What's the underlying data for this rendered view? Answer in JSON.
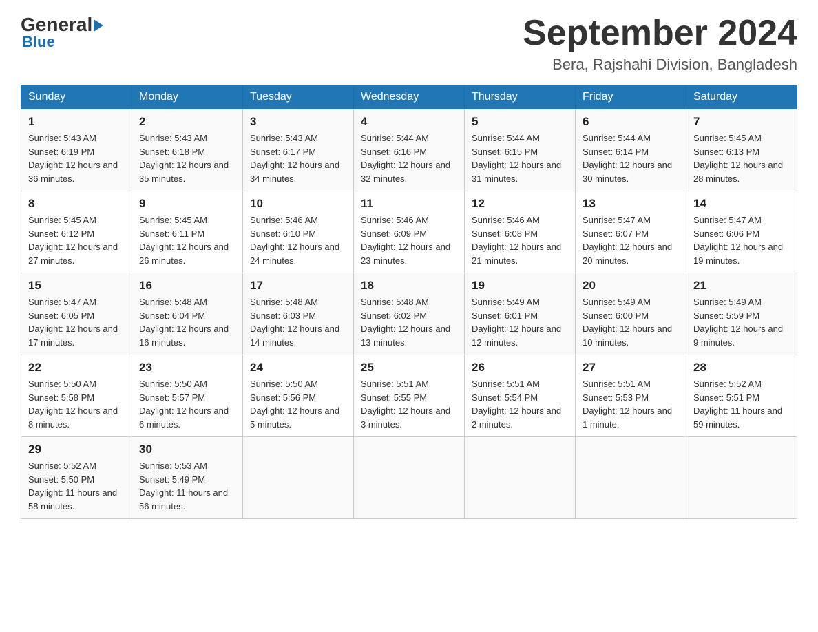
{
  "logo": {
    "general": "General",
    "blue": "Blue"
  },
  "header": {
    "title": "September 2024",
    "subtitle": "Bera, Rajshahi Division, Bangladesh"
  },
  "days_of_week": [
    "Sunday",
    "Monday",
    "Tuesday",
    "Wednesday",
    "Thursday",
    "Friday",
    "Saturday"
  ],
  "weeks": [
    [
      {
        "day": "1",
        "sunrise": "5:43 AM",
        "sunset": "6:19 PM",
        "daylight": "12 hours and 36 minutes."
      },
      {
        "day": "2",
        "sunrise": "5:43 AM",
        "sunset": "6:18 PM",
        "daylight": "12 hours and 35 minutes."
      },
      {
        "day": "3",
        "sunrise": "5:43 AM",
        "sunset": "6:17 PM",
        "daylight": "12 hours and 34 minutes."
      },
      {
        "day": "4",
        "sunrise": "5:44 AM",
        "sunset": "6:16 PM",
        "daylight": "12 hours and 32 minutes."
      },
      {
        "day": "5",
        "sunrise": "5:44 AM",
        "sunset": "6:15 PM",
        "daylight": "12 hours and 31 minutes."
      },
      {
        "day": "6",
        "sunrise": "5:44 AM",
        "sunset": "6:14 PM",
        "daylight": "12 hours and 30 minutes."
      },
      {
        "day": "7",
        "sunrise": "5:45 AM",
        "sunset": "6:13 PM",
        "daylight": "12 hours and 28 minutes."
      }
    ],
    [
      {
        "day": "8",
        "sunrise": "5:45 AM",
        "sunset": "6:12 PM",
        "daylight": "12 hours and 27 minutes."
      },
      {
        "day": "9",
        "sunrise": "5:45 AM",
        "sunset": "6:11 PM",
        "daylight": "12 hours and 26 minutes."
      },
      {
        "day": "10",
        "sunrise": "5:46 AM",
        "sunset": "6:10 PM",
        "daylight": "12 hours and 24 minutes."
      },
      {
        "day": "11",
        "sunrise": "5:46 AM",
        "sunset": "6:09 PM",
        "daylight": "12 hours and 23 minutes."
      },
      {
        "day": "12",
        "sunrise": "5:46 AM",
        "sunset": "6:08 PM",
        "daylight": "12 hours and 21 minutes."
      },
      {
        "day": "13",
        "sunrise": "5:47 AM",
        "sunset": "6:07 PM",
        "daylight": "12 hours and 20 minutes."
      },
      {
        "day": "14",
        "sunrise": "5:47 AM",
        "sunset": "6:06 PM",
        "daylight": "12 hours and 19 minutes."
      }
    ],
    [
      {
        "day": "15",
        "sunrise": "5:47 AM",
        "sunset": "6:05 PM",
        "daylight": "12 hours and 17 minutes."
      },
      {
        "day": "16",
        "sunrise": "5:48 AM",
        "sunset": "6:04 PM",
        "daylight": "12 hours and 16 minutes."
      },
      {
        "day": "17",
        "sunrise": "5:48 AM",
        "sunset": "6:03 PM",
        "daylight": "12 hours and 14 minutes."
      },
      {
        "day": "18",
        "sunrise": "5:48 AM",
        "sunset": "6:02 PM",
        "daylight": "12 hours and 13 minutes."
      },
      {
        "day": "19",
        "sunrise": "5:49 AM",
        "sunset": "6:01 PM",
        "daylight": "12 hours and 12 minutes."
      },
      {
        "day": "20",
        "sunrise": "5:49 AM",
        "sunset": "6:00 PM",
        "daylight": "12 hours and 10 minutes."
      },
      {
        "day": "21",
        "sunrise": "5:49 AM",
        "sunset": "5:59 PM",
        "daylight": "12 hours and 9 minutes."
      }
    ],
    [
      {
        "day": "22",
        "sunrise": "5:50 AM",
        "sunset": "5:58 PM",
        "daylight": "12 hours and 8 minutes."
      },
      {
        "day": "23",
        "sunrise": "5:50 AM",
        "sunset": "5:57 PM",
        "daylight": "12 hours and 6 minutes."
      },
      {
        "day": "24",
        "sunrise": "5:50 AM",
        "sunset": "5:56 PM",
        "daylight": "12 hours and 5 minutes."
      },
      {
        "day": "25",
        "sunrise": "5:51 AM",
        "sunset": "5:55 PM",
        "daylight": "12 hours and 3 minutes."
      },
      {
        "day": "26",
        "sunrise": "5:51 AM",
        "sunset": "5:54 PM",
        "daylight": "12 hours and 2 minutes."
      },
      {
        "day": "27",
        "sunrise": "5:51 AM",
        "sunset": "5:53 PM",
        "daylight": "12 hours and 1 minute."
      },
      {
        "day": "28",
        "sunrise": "5:52 AM",
        "sunset": "5:51 PM",
        "daylight": "11 hours and 59 minutes."
      }
    ],
    [
      {
        "day": "29",
        "sunrise": "5:52 AM",
        "sunset": "5:50 PM",
        "daylight": "11 hours and 58 minutes."
      },
      {
        "day": "30",
        "sunrise": "5:53 AM",
        "sunset": "5:49 PM",
        "daylight": "11 hours and 56 minutes."
      },
      null,
      null,
      null,
      null,
      null
    ]
  ],
  "labels": {
    "sunrise": "Sunrise:",
    "sunset": "Sunset:",
    "daylight": "Daylight:"
  }
}
